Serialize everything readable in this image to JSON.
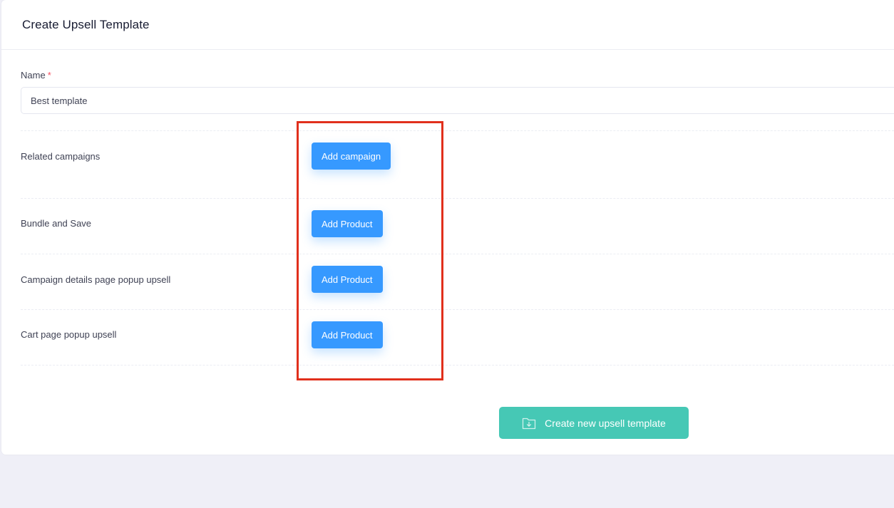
{
  "header": {
    "title": "Create Upsell Template"
  },
  "form": {
    "name_label": "Name",
    "required_mark": "*",
    "name_value": "Best template"
  },
  "sections": [
    {
      "label": "Related campaigns",
      "button_label": "Add campaign"
    },
    {
      "label": "Bundle and Save",
      "button_label": "Add Product"
    },
    {
      "label": "Campaign details page popup upsell",
      "button_label": "Add Product"
    },
    {
      "label": "Cart page popup upsell",
      "button_label": "Add Product"
    }
  ],
  "footer": {
    "submit_label": "Create new upsell template",
    "submit_icon": "folder-download-icon"
  },
  "colors": {
    "primary": "#3699ff",
    "submit": "#46c8b5",
    "highlight": "#e1301c",
    "required": "#f64e60"
  }
}
